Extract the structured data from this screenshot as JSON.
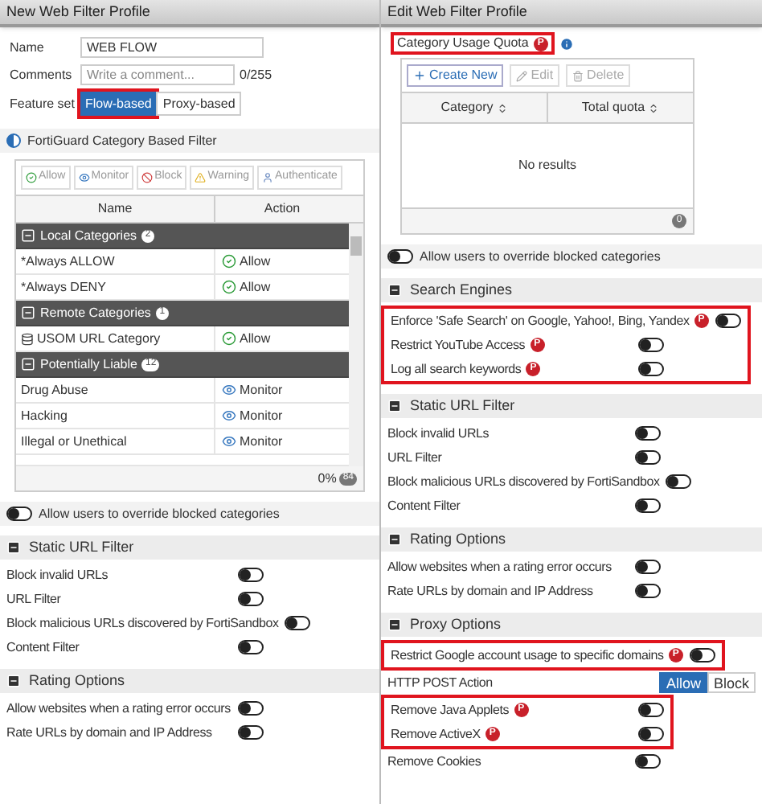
{
  "left": {
    "title": "New Web Filter Profile",
    "fields": [
      {
        "label": "Name",
        "value": "WEB FLOW"
      },
      {
        "label": "Comments",
        "placeholder": "Write a comment...",
        "counter": "0/255"
      }
    ],
    "feature_set": {
      "label": "Feature set",
      "options": [
        {
          "label": "Flow-based",
          "selected": true,
          "highlighted": true
        },
        {
          "label": "Proxy-based",
          "selected": false,
          "highlighted": false
        }
      ]
    },
    "fortiguard": {
      "title": "FortiGuard Category Based Filter",
      "on": true
    },
    "actions": [
      {
        "label": "Allow",
        "kind": "allow"
      },
      {
        "label": "Monitor",
        "kind": "monitor"
      },
      {
        "label": "Block",
        "kind": "block"
      },
      {
        "label": "Warning",
        "kind": "warning"
      },
      {
        "label": "Authenticate",
        "kind": "authenticate"
      }
    ],
    "table": {
      "columns": [
        "Name",
        "Action"
      ],
      "rows": [
        {
          "kind": "group",
          "label": "Local Categories",
          "count": "2"
        },
        {
          "kind": "item",
          "name": "*Always ALLOW",
          "action": {
            "kind": "allow",
            "label": "Allow"
          }
        },
        {
          "kind": "item",
          "name": "*Always DENY",
          "action": {
            "kind": "allow",
            "label": "Allow"
          }
        },
        {
          "kind": "group",
          "label": "Remote Categories",
          "count": "1"
        },
        {
          "kind": "remote",
          "name": "USOM URL Category",
          "action": {
            "kind": "allow",
            "label": "Allow"
          }
        },
        {
          "kind": "group",
          "label": "Potentially Liable",
          "count": "12"
        },
        {
          "kind": "item",
          "name": "Drug Abuse",
          "action": {
            "kind": "monitor",
            "label": "Monitor"
          }
        },
        {
          "kind": "item",
          "name": "Hacking",
          "action": {
            "kind": "monitor",
            "label": "Monitor"
          }
        },
        {
          "kind": "item",
          "name": "Illegal or Unethical",
          "action": {
            "kind": "monitor",
            "label": "Monitor"
          }
        }
      ],
      "footer": "0%",
      "footer_count": "84"
    },
    "override": {
      "label": "Allow users to override blocked categories",
      "on": false
    },
    "sections": [
      {
        "title": "Static URL Filter",
        "items": [
          {
            "kind": "toggle",
            "label": "Block invalid URLs",
            "on": false
          },
          {
            "kind": "toggle",
            "label": "URL Filter",
            "on": false
          },
          {
            "kind": "toggle",
            "label": "Block malicious URLs discovered by FortiSandbox",
            "on": false
          },
          {
            "kind": "toggle",
            "label": "Content Filter",
            "on": false
          }
        ]
      },
      {
        "title": "Rating Options",
        "items": [
          {
            "kind": "toggle",
            "label": "Allow websites when a rating error occurs",
            "on": false
          },
          {
            "kind": "toggle",
            "label": "Rate URLs by domain and IP Address",
            "on": false
          }
        ]
      }
    ]
  },
  "right": {
    "title": "Edit Web Filter Profile",
    "quota": {
      "title": "Category Usage Quota",
      "badge": "P",
      "highlighted": true,
      "buttons": [
        {
          "label": "Create New",
          "kind": "create",
          "disabled": false
        },
        {
          "label": "Edit",
          "kind": "edit",
          "disabled": true
        },
        {
          "label": "Delete",
          "kind": "delete",
          "disabled": true
        }
      ],
      "columns": [
        "Category",
        "Total quota"
      ],
      "empty": "No results",
      "count": "0"
    },
    "override": {
      "label": "Allow users to override blocked categories",
      "on": false
    },
    "sections": [
      {
        "title": "Search Engines",
        "items": [
          {
            "kind": "toggle",
            "label": "Enforce 'Safe Search' on Google, Yahoo!, Bing, Yandex",
            "badge": "P",
            "on": false,
            "highlighted": true
          },
          {
            "kind": "toggle",
            "label": "Restrict YouTube Access",
            "badge": "P",
            "on": false,
            "highlighted": true
          },
          {
            "kind": "toggle",
            "label": "Log all search keywords",
            "badge": "P",
            "on": false,
            "highlighted": true
          }
        ]
      },
      {
        "title": "Static URL Filter",
        "items": [
          {
            "kind": "toggle",
            "label": "Block invalid URLs",
            "on": false
          },
          {
            "kind": "toggle",
            "label": "URL Filter",
            "on": false
          },
          {
            "kind": "toggle",
            "label": "Block malicious URLs discovered by FortiSandbox",
            "on": false
          },
          {
            "kind": "toggle",
            "label": "Content Filter",
            "on": false
          }
        ]
      },
      {
        "title": "Rating Options",
        "items": [
          {
            "kind": "toggle",
            "label": "Allow websites when a rating error occurs",
            "on": false
          },
          {
            "kind": "toggle",
            "label": "Rate URLs by domain and IP Address",
            "on": false
          }
        ]
      },
      {
        "title": "Proxy Options",
        "items": [
          {
            "kind": "toggle",
            "label": "Restrict Google account usage to specific domains",
            "badge": "P",
            "on": false,
            "highlighted": true
          },
          {
            "kind": "segmented",
            "label": "HTTP POST Action",
            "options": [
              {
                "label": "Allow",
                "selected": true
              },
              {
                "label": "Block",
                "selected": false
              }
            ]
          },
          {
            "kind": "toggle",
            "label": "Remove Java Applets",
            "badge": "P",
            "on": false,
            "highlighted": true
          },
          {
            "kind": "toggle",
            "label": "Remove ActiveX",
            "badge": "P",
            "on": false,
            "highlighted": true
          },
          {
            "kind": "toggle",
            "label": "Remove Cookies",
            "on": false
          }
        ]
      }
    ]
  }
}
